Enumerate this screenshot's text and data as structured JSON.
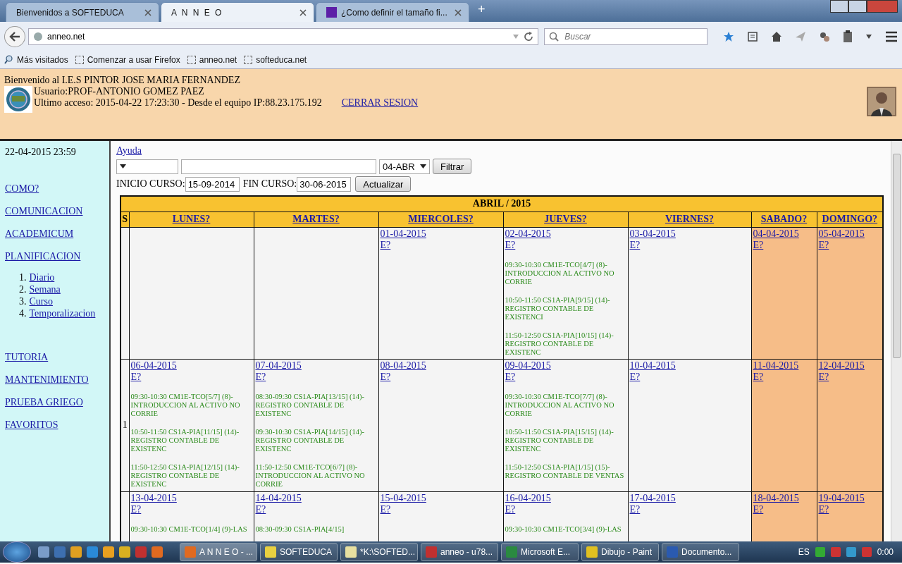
{
  "browser": {
    "tabs": [
      {
        "label": "Bienvenidos a SOFTEDUCA",
        "selected": false,
        "kind": "plain"
      },
      {
        "label": "A N N E O",
        "selected": true,
        "kind": "plain"
      },
      {
        "label": "¿Como definir el tamaño fi...",
        "selected": false,
        "kind": "yahoo"
      }
    ],
    "new_tab": "+",
    "url": "anneo.net",
    "search_placeholder": "Buscar",
    "bookmarks": [
      {
        "label": "Más visitados",
        "kind": "search"
      },
      {
        "label": "Comenzar a usar Firefox",
        "kind": "page"
      },
      {
        "label": "anneo.net",
        "kind": "page"
      },
      {
        "label": "softeduca.net",
        "kind": "page"
      }
    ]
  },
  "header": {
    "welcome": "Bienvenido al I.E.S PINTOR JOSE MARIA FERNANDEZ",
    "user": "Usuario:PROF-ANTONIO GOMEZ PAEZ",
    "last_access": "Ultimo acceso: 2015-04-22 17:23:30 - Desde el equipo IP:88.23.175.192",
    "logout": "CERRAR SESION"
  },
  "sidebar": {
    "datetime": "22-04-2015 23:59",
    "items": [
      {
        "label": "COMO?"
      },
      {
        "label": "COMUNICACION"
      },
      {
        "label": "ACADEMICUM"
      },
      {
        "label": "PLANIFICACION",
        "children": [
          {
            "number": "1.",
            "label": "Diario"
          },
          {
            "number": "2.",
            "label": "Semana"
          },
          {
            "number": "3.",
            "label": "Curso"
          },
          {
            "number": "4.",
            "label": "Temporalizacion"
          }
        ]
      },
      {
        "label": "TUTORIA"
      },
      {
        "label": "MANTENIMIENTO"
      },
      {
        "label": "PRUEBA GRIEGO"
      },
      {
        "label": "FAVORITOS"
      }
    ]
  },
  "toolbar": {
    "help": "Ayuda",
    "month_select": "04-ABR",
    "filter_button": "Filtrar",
    "start_label": "INICIO CURSO:",
    "start_value": "15-09-2014",
    "end_label": "FIN CURSO:",
    "end_value": "30-06-2015",
    "update_button": "Actualizar"
  },
  "calendar": {
    "title": "ABRIL / 2015",
    "week_column": "S",
    "columns": [
      "LUNES?",
      "MARTES?",
      "MIERCOLES?",
      "JUEVES?",
      "VIERNES?",
      "SABADO?",
      "DOMINGO?"
    ],
    "weeks": [
      {
        "days": [
          {
            "kind": "empty"
          },
          {
            "kind": "empty"
          },
          {
            "kind": "day",
            "date": "01-04-2015",
            "link": "E?",
            "weekend": false
          },
          {
            "kind": "day",
            "date": "02-04-2015",
            "link": "E?",
            "weekend": false,
            "events": [
              "09:30-10:30 CM1E-TCO[4/7] (8)-INTRODUCCION AL ACTIVO NO CORRIE",
              "10:50-11:50 CS1A-PIA[9/15] (14)-REGISTRO CONTABLE DE EXISTENCI",
              "11:50-12:50 CS1A-PIA[10/15] (14)-REGISTRO CONTABLE DE EXISTENC"
            ]
          },
          {
            "kind": "day",
            "date": "03-04-2015",
            "link": "E?",
            "weekend": false
          },
          {
            "kind": "day",
            "date": "04-04-2015",
            "link": "E?",
            "weekend": true
          },
          {
            "kind": "day",
            "date": "05-04-2015",
            "link": "E?",
            "weekend": true
          }
        ]
      },
      {
        "number": "1",
        "days": [
          {
            "kind": "day",
            "date": "06-04-2015",
            "link": "E?",
            "weekend": false,
            "events": [
              "09:30-10:30 CM1E-TCO[5/7] (8)-INTRODUCCION AL ACTIVO NO CORRIE",
              "10:50-11:50 CS1A-PIA[11/15] (14)-REGISTRO CONTABLE DE EXISTENC",
              "11:50-12:50 CS1A-PIA[12/15] (14)-REGISTRO CONTABLE DE EXISTENC"
            ]
          },
          {
            "kind": "day",
            "date": "07-04-2015",
            "link": "E?",
            "weekend": false,
            "events": [
              "08:30-09:30 CS1A-PIA[13/15] (14)-REGISTRO CONTABLE DE EXISTENC",
              "09:30-10:30 CS1A-PIA[14/15] (14)-REGISTRO CONTABLE DE EXISTENC",
              "11:50-12:50 CM1E-TCO[6/7] (8)-INTRODUCCION AL ACTIVO NO CORRIE"
            ]
          },
          {
            "kind": "day",
            "date": "08-04-2015",
            "link": "E?",
            "weekend": false
          },
          {
            "kind": "day",
            "date": "09-04-2015",
            "link": "E?",
            "weekend": false,
            "events": [
              "09:30-10:30 CM1E-TCO[7/7] (8)-INTRODUCCION AL ACTIVO NO CORRIE",
              "10:50-11:50 CS1A-PIA[15/15] (14)-REGISTRO CONTABLE DE EXISTENC",
              "11:50-12:50 CS1A-PIA[1/15] (15)-REGISTRO CONTABLE DE VENTAS"
            ]
          },
          {
            "kind": "day",
            "date": "10-04-2015",
            "link": "E?",
            "weekend": false
          },
          {
            "kind": "day",
            "date": "11-04-2015",
            "link": "E?",
            "weekend": true
          },
          {
            "kind": "day",
            "date": "12-04-2015",
            "link": "E?",
            "weekend": true
          }
        ]
      },
      {
        "days": [
          {
            "kind": "day",
            "date": "13-04-2015",
            "link": "E?",
            "weekend": false,
            "events": [
              "09:30-10:30 CM1E-TCO[1/4] (9)-LAS"
            ]
          },
          {
            "kind": "day",
            "date": "14-04-2015",
            "link": "E?",
            "weekend": false,
            "events": [
              "08:30-09:30 CS1A-PIA[4/15]"
            ]
          },
          {
            "kind": "day",
            "date": "15-04-2015",
            "link": "E?",
            "weekend": false
          },
          {
            "kind": "day",
            "date": "16-04-2015",
            "link": "E?",
            "weekend": false,
            "events": [
              "09:30-10:30 CM1E-TCO[3/4] (9)-LAS"
            ]
          },
          {
            "kind": "day",
            "date": "17-04-2015",
            "link": "E?",
            "weekend": false
          },
          {
            "kind": "day",
            "date": "18-04-2015",
            "link": "E?",
            "weekend": true
          },
          {
            "kind": "day",
            "date": "19-04-2015",
            "link": "E?",
            "weekend": true
          }
        ]
      }
    ]
  },
  "taskbar": {
    "quick_launch": [
      {
        "kind": "desktop"
      },
      {
        "kind": "window"
      },
      {
        "kind": "chrome"
      },
      {
        "kind": "ie"
      },
      {
        "kind": "media"
      },
      {
        "kind": "winamp"
      },
      {
        "kind": "filezilla"
      },
      {
        "kind": "firefox"
      }
    ],
    "tasks": [
      {
        "label": "A N N E O - ...",
        "kind": "firefox",
        "selected": true
      },
      {
        "label": "SOFTEDUCA",
        "kind": "doc",
        "selected": false
      },
      {
        "label": "*K:\\SOFTED...",
        "kind": "note",
        "selected": false
      },
      {
        "label": "anneo - u78...",
        "kind": "filezilla",
        "selected": false
      },
      {
        "label": "Microsoft E...",
        "kind": "excel",
        "selected": false
      },
      {
        "label": "Dibujo - Paint",
        "kind": "paint",
        "selected": false
      },
      {
        "label": "Documento...",
        "kind": "word",
        "selected": false
      }
    ],
    "language": "ES",
    "clock": "0:00"
  }
}
